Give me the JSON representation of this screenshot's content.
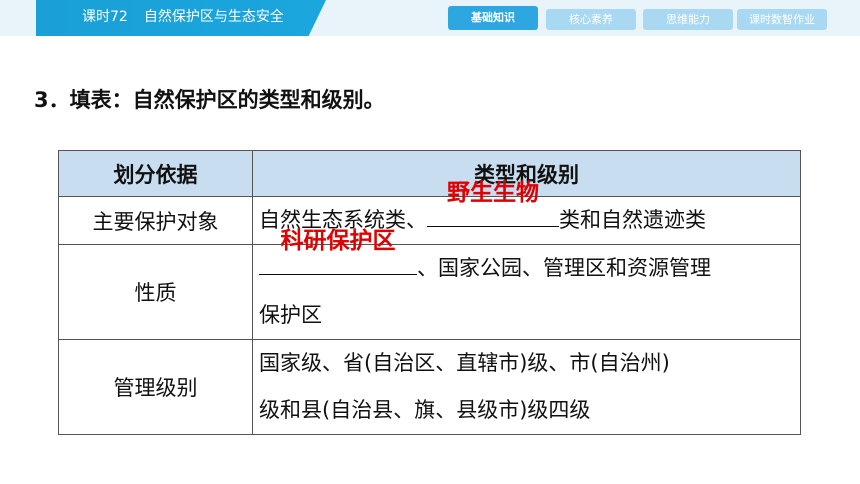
{
  "header": {
    "lesson_number": "课时72",
    "lesson_title": "自然保护区与生态安全",
    "tabs": [
      {
        "label": "基础知识",
        "active": true
      },
      {
        "label": "核心素养",
        "active": false
      },
      {
        "label": "思维能力",
        "active": false
      },
      {
        "label": "课时数智作业",
        "active": false
      }
    ]
  },
  "question": {
    "text": "3．填表：自然保护区的类型和级别。"
  },
  "table": {
    "headers": [
      "划分依据",
      "类型和级别"
    ],
    "rows": [
      {
        "basis": "主要保护对象",
        "before": "自然生态系统类、",
        "answer": "野生生物",
        "after": "类和自然遗迹类"
      },
      {
        "basis": "性质",
        "answer": "科研保护区",
        "after_line1": "、国家公园、管理区和资源管理",
        "line2": "保护区"
      },
      {
        "basis": "管理级别",
        "line1": "国家级、省(自治区、直辖市)级、市(自治州)",
        "line2": "级和县(自治县、旗、县级市)级四级"
      }
    ]
  },
  "colors": {
    "banner": "#1ba6de",
    "active_tab": "#2ea7e0",
    "inactive_tab": "#a9d8f3",
    "header_fill": "#c8ddf0",
    "answer": "#e00000"
  }
}
